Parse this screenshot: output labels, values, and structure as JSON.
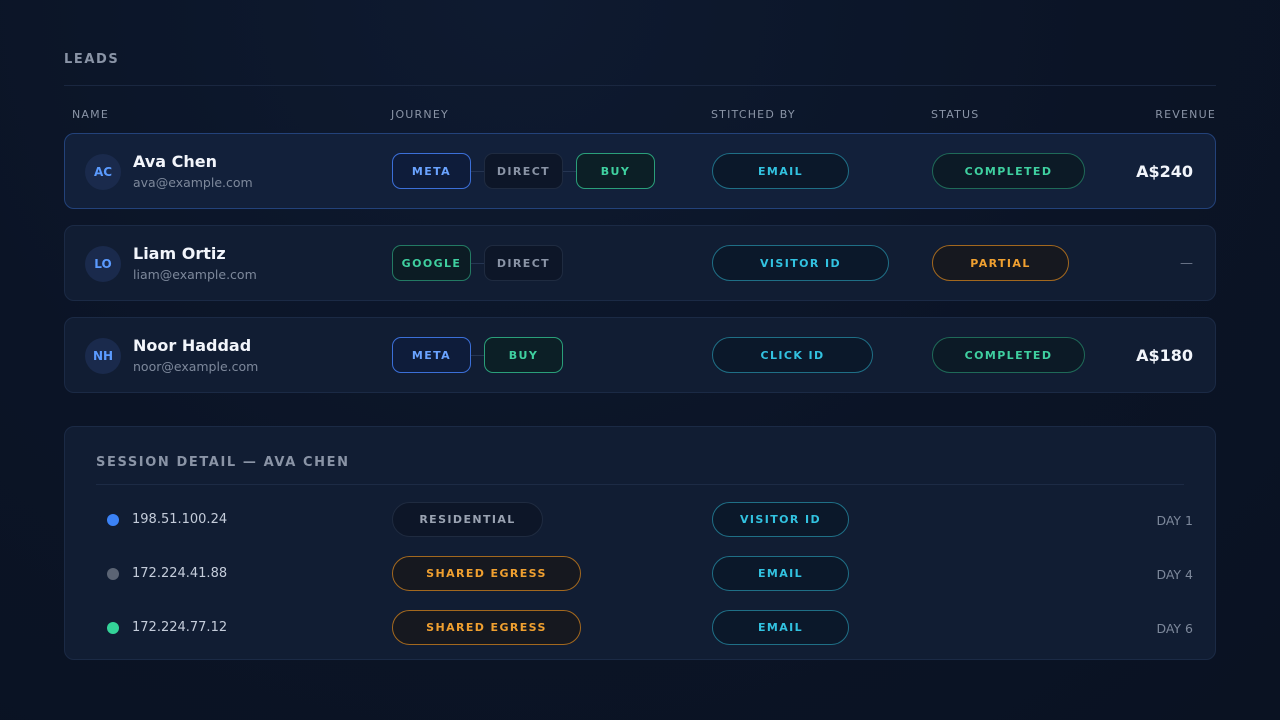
{
  "leads": {
    "title": "LEADS",
    "columns": [
      "NAME",
      "JOURNEY",
      "STITCHED BY",
      "STATUS",
      "REVENUE"
    ],
    "rows": [
      {
        "initials": "AC",
        "name": "Ava Chen",
        "email": "ava@example.com",
        "journey": [
          "META",
          "DIRECT",
          "BUY"
        ],
        "stitched_by": "EMAIL",
        "status": "COMPLETED",
        "revenue": "A$240"
      },
      {
        "initials": "LO",
        "name": "Liam Ortiz",
        "email": "liam@example.com",
        "journey": [
          "GOOGLE",
          "DIRECT"
        ],
        "stitched_by": "VISITOR ID",
        "status": "PARTIAL",
        "revenue": "—"
      },
      {
        "initials": "NH",
        "name": "Noor Haddad",
        "email": "noor@example.com",
        "journey": [
          "META",
          "BUY"
        ],
        "stitched_by": "CLICK ID",
        "status": "COMPLETED",
        "revenue": "A$180"
      }
    ]
  },
  "session_detail": {
    "title": "SESSION DETAIL — AVA CHEN",
    "rows": [
      {
        "dot_color": "#3b82f6",
        "ip": "198.51.100.24",
        "network": "RESIDENTIAL",
        "stitched_by": "VISITOR ID",
        "day": "DAY 1"
      },
      {
        "dot_color": "#5b6474",
        "ip": "172.224.41.88",
        "network": "SHARED EGRESS",
        "stitched_by": "EMAIL",
        "day": "DAY 4"
      },
      {
        "dot_color": "#34d399",
        "ip": "172.224.77.12",
        "network": "SHARED EGRESS",
        "stitched_by": "EMAIL",
        "day": "DAY 6"
      }
    ]
  },
  "colors": {
    "accent_blue": "#6aa3ff",
    "accent_teal": "#32c2e0",
    "success_green": "#3fd0a0",
    "warning_orange": "#f0a030"
  }
}
